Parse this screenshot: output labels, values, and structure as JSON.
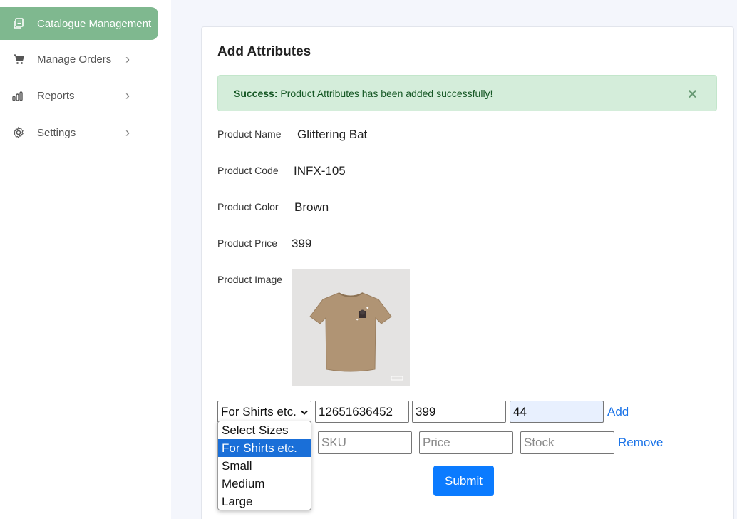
{
  "sidebar": {
    "items": [
      {
        "label": "Catalogue Management",
        "icon": "catalogue-icon",
        "active": true
      },
      {
        "label": "Manage Orders",
        "icon": "cart-icon"
      },
      {
        "label": "Reports",
        "icon": "bar-chart-icon"
      },
      {
        "label": "Settings",
        "icon": "gear-icon"
      }
    ],
    "chevron": "›"
  },
  "card": {
    "title": "Add Attributes",
    "alert": {
      "strong": "Success:",
      "message": " Product Attributes has been added successfully!",
      "close": "×"
    },
    "fields": {
      "name": {
        "label": "Product Name",
        "value": "Glittering Bat"
      },
      "code": {
        "label": "Product Code",
        "value": "INFX-105"
      },
      "color": {
        "label": "Product Color",
        "value": "Brown"
      },
      "price": {
        "label": "Product Price",
        "value": "399"
      },
      "image": {
        "label": "Product Image"
      }
    },
    "row1": {
      "size": "For Shirts etc.",
      "sku": "12651636452",
      "price": "399",
      "stock": "44",
      "action": "Add"
    },
    "row2": {
      "sku_placeholder": "SKU",
      "price_placeholder": "Price",
      "stock_placeholder": "Stock",
      "action": "Remove"
    },
    "submit": "Submit",
    "size_options": [
      "Select Sizes",
      "For Shirts etc.",
      "Small",
      "Medium",
      "Large"
    ],
    "selected_option": "For Shirts etc."
  },
  "colors": {
    "sidebar_active": "#7fb88f",
    "alert_bg": "#d4edda",
    "alert_text": "#155724",
    "primary": "#0b7bff",
    "link": "#1a73e8"
  }
}
